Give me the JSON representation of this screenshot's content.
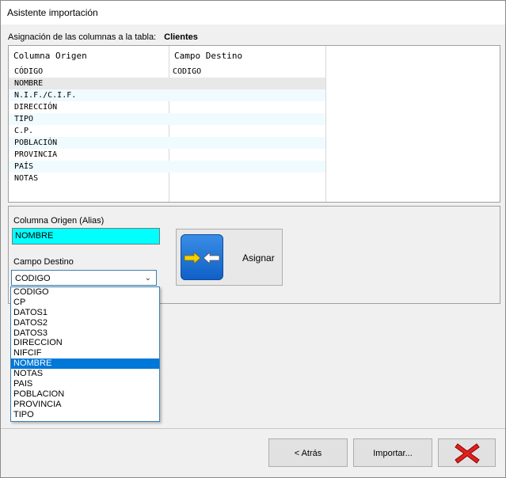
{
  "window": {
    "title": "Asistente importación"
  },
  "header": {
    "label": "Asignación de las columnas a la tabla:",
    "table_name": "Clientes"
  },
  "grid": {
    "columns": [
      "Columna Origen",
      "Campo Destino"
    ],
    "rows": [
      {
        "origen": "CÓDIGO",
        "destino": "CODIGO"
      },
      {
        "origen": "NOMBRE",
        "destino": ""
      },
      {
        "origen": "N.I.F./C.I.F.",
        "destino": ""
      },
      {
        "origen": "DIRECCIÓN",
        "destino": ""
      },
      {
        "origen": "TIPO",
        "destino": ""
      },
      {
        "origen": "C.P.",
        "destino": ""
      },
      {
        "origen": "POBLACIÓN",
        "destino": ""
      },
      {
        "origen": "PROVINCIA",
        "destino": ""
      },
      {
        "origen": "PAÍS",
        "destino": ""
      },
      {
        "origen": "NOTAS",
        "destino": ""
      }
    ],
    "selected_row": 1
  },
  "panel": {
    "origen_label": "Columna Origen (Alias)",
    "origen_value": "NOMBRE",
    "destino_label": "Campo Destino",
    "destino_value": "CODIGO",
    "assign_label": "Asignar"
  },
  "dropdown": {
    "options": [
      "CODIGO",
      "CP",
      "DATOS1",
      "DATOS2",
      "DATOS3",
      "DIRECCION",
      "NIFCIF",
      "NOMBRE",
      "NOTAS",
      "PAIS",
      "POBLACION",
      "PROVINCIA",
      "TIPO"
    ],
    "selected_index": 7
  },
  "footer": {
    "back_label": "< Atrás",
    "import_label": "Importar...",
    "close_icon": "red-x-icon"
  },
  "colors": {
    "origen_bg": "#00ffff",
    "selection": "#0078d7",
    "close_red": "#e02020"
  }
}
